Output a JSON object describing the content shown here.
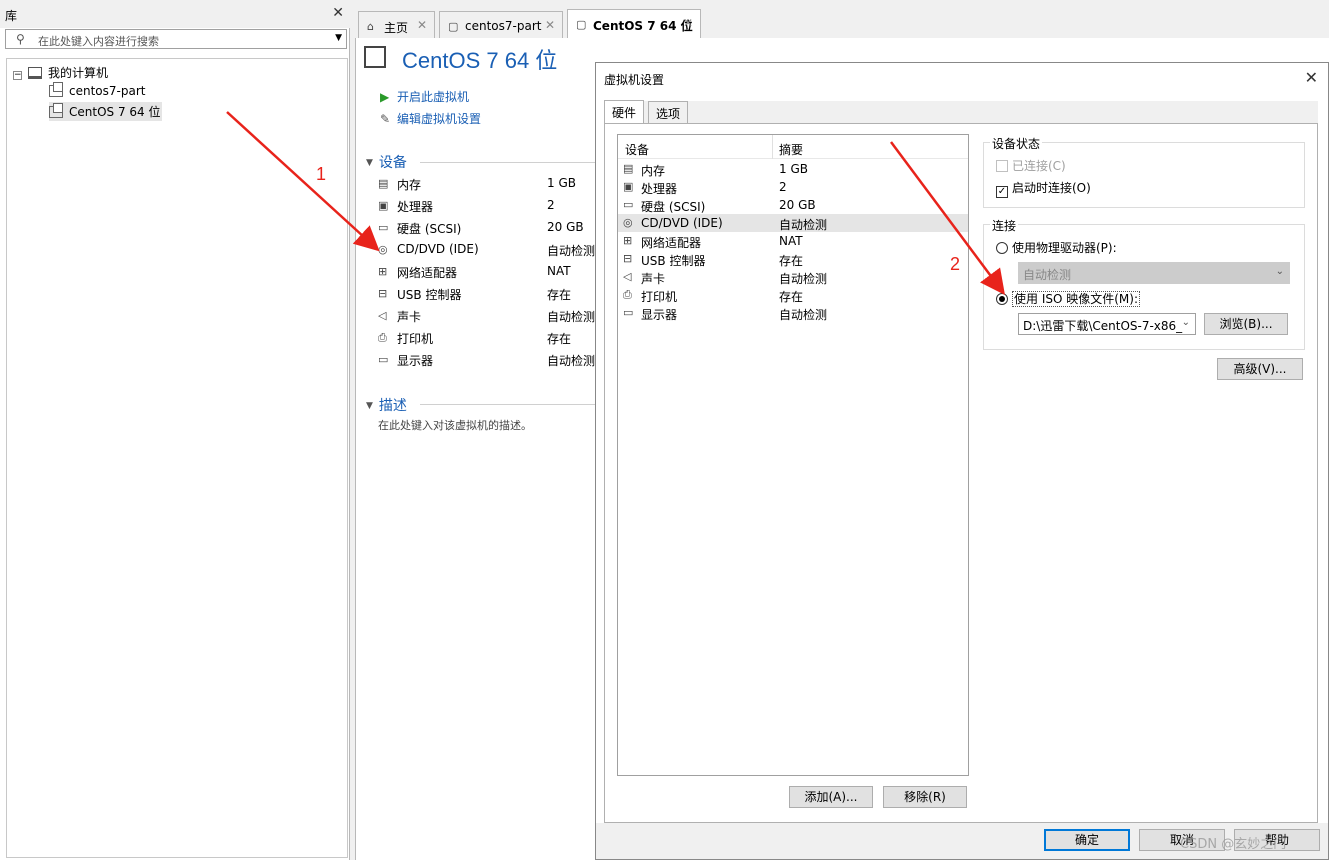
{
  "library": {
    "title": "库",
    "search_placeholder": "在此处键入内容进行搜索",
    "tree": {
      "root": "我的计算机",
      "items": [
        "centos7-part",
        "CentOS 7 64 位"
      ]
    }
  },
  "tabs": [
    {
      "label": "主页",
      "icon": "home-icon"
    },
    {
      "label": "centos7-part",
      "icon": "vm-icon"
    },
    {
      "label": "CentOS 7 64 位",
      "icon": "vm-icon"
    }
  ],
  "vm": {
    "title": "CentOS 7 64 位",
    "actions": [
      "开启此虚拟机",
      "编辑虚拟机设置"
    ],
    "devices_heading": "设备",
    "devices": [
      {
        "name": "内存",
        "value": "1 GB",
        "icon": "memory-icon"
      },
      {
        "name": "处理器",
        "value": "2",
        "icon": "cpu-icon"
      },
      {
        "name": "硬盘 (SCSI)",
        "value": "20 GB",
        "icon": "disk-icon"
      },
      {
        "name": "CD/DVD (IDE)",
        "value": "自动检测",
        "icon": "cd-icon"
      },
      {
        "name": "网络适配器",
        "value": "NAT",
        "icon": "network-icon"
      },
      {
        "name": "USB 控制器",
        "value": "存在",
        "icon": "usb-icon"
      },
      {
        "name": "声卡",
        "value": "自动检测",
        "icon": "sound-icon"
      },
      {
        "name": "打印机",
        "value": "存在",
        "icon": "printer-icon"
      },
      {
        "name": "显示器",
        "value": "自动检测",
        "icon": "monitor-icon"
      }
    ],
    "desc_heading": "描述",
    "desc_placeholder": "在此处键入对该虚拟机的描述。"
  },
  "annotations": {
    "one": "1",
    "two": "2",
    "color": "#e8231b"
  },
  "dialog": {
    "title": "虚拟机设置",
    "tabs": [
      "硬件",
      "选项"
    ],
    "list_headers": {
      "device": "设备",
      "summary": "摘要"
    },
    "devices": [
      {
        "name": "内存",
        "summary": "1 GB"
      },
      {
        "name": "处理器",
        "summary": "2"
      },
      {
        "name": "硬盘 (SCSI)",
        "summary": "20 GB"
      },
      {
        "name": "CD/DVD (IDE)",
        "summary": "自动检测"
      },
      {
        "name": "网络适配器",
        "summary": "NAT"
      },
      {
        "name": "USB 控制器",
        "summary": "存在"
      },
      {
        "name": "声卡",
        "summary": "自动检测"
      },
      {
        "name": "打印机",
        "summary": "存在"
      },
      {
        "name": "显示器",
        "summary": "自动检测"
      }
    ],
    "add_button": "添加(A)...",
    "remove_button": "移除(R)",
    "device_status": {
      "title": "设备状态",
      "connected": "已连接(C)",
      "connect_at_power_on": "启动时连接(O)"
    },
    "connection": {
      "title": "连接",
      "physical_drive": "使用物理驱动器(P):",
      "physical_value": "自动检测",
      "iso_image": "使用 ISO 映像文件(M):",
      "iso_path": "D:\\迅雷下载\\CentOS-7-x86_",
      "browse": "浏览(B)..."
    },
    "advanced": "高级(V)...",
    "ok": "确定",
    "cancel": "取消",
    "help": "帮助"
  },
  "watermark": "CSDN @玄妙之门"
}
